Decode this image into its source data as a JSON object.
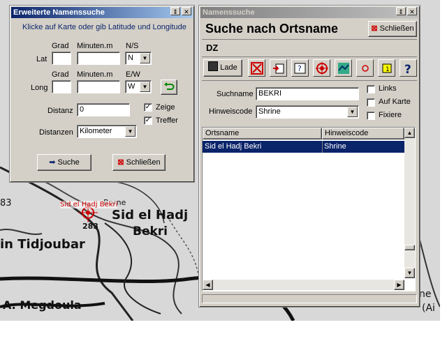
{
  "map": {
    "labels": [
      "Sid el Hadj",
      "Bekri",
      "in Tidjoubar",
      "A. Megdoula",
      "Borne",
      "283",
      "83",
      "ne",
      "(Ai"
    ],
    "marker_label": "Sid el Hadj Bekri"
  },
  "ext_window": {
    "title": "Erweiterte Namenssuche",
    "instruction": "Klicke auf Karte oder gib Latitude und Longitude",
    "lat_label": "Lat",
    "long_label": "Long",
    "grad_label": "Grad",
    "minuten_label": "Minuten.m",
    "ns_label": "N/S",
    "ew_label": "E/W",
    "ns_value": "N",
    "ew_value": "W",
    "distanz_label": "Distanz",
    "distanz_value": "0",
    "distanzen_label": "Distanzen",
    "distanzen_value": "Kilometer",
    "zeige_label": "Zeige",
    "treffer_label": "Treffer",
    "suche_button": "Suche",
    "close_button": "Schließen"
  },
  "name_window": {
    "title": "Namenssuche",
    "heading": "Suche nach Ortsname",
    "close_button": "Schließen",
    "country": "DZ",
    "lade_button": "Lade",
    "suchname_label": "Suchname",
    "suchname_value": "BEKRI",
    "hinweiscode_label": "Hinweiscode",
    "hinweiscode_value": "Shrine",
    "links_label": "Links",
    "auf_karte_label": "Auf Karte",
    "fixiere_label": "Fixiere",
    "columns": [
      "Ortsname",
      "Hinweiscode"
    ],
    "rows": [
      {
        "ortsname": "Sid el Hadj Bekri",
        "hinweiscode": "Shrine"
      }
    ]
  },
  "colors": {
    "titlebar_active": "#0a246a",
    "selection": "#0a246a",
    "window_bg": "#d4d0c8"
  }
}
